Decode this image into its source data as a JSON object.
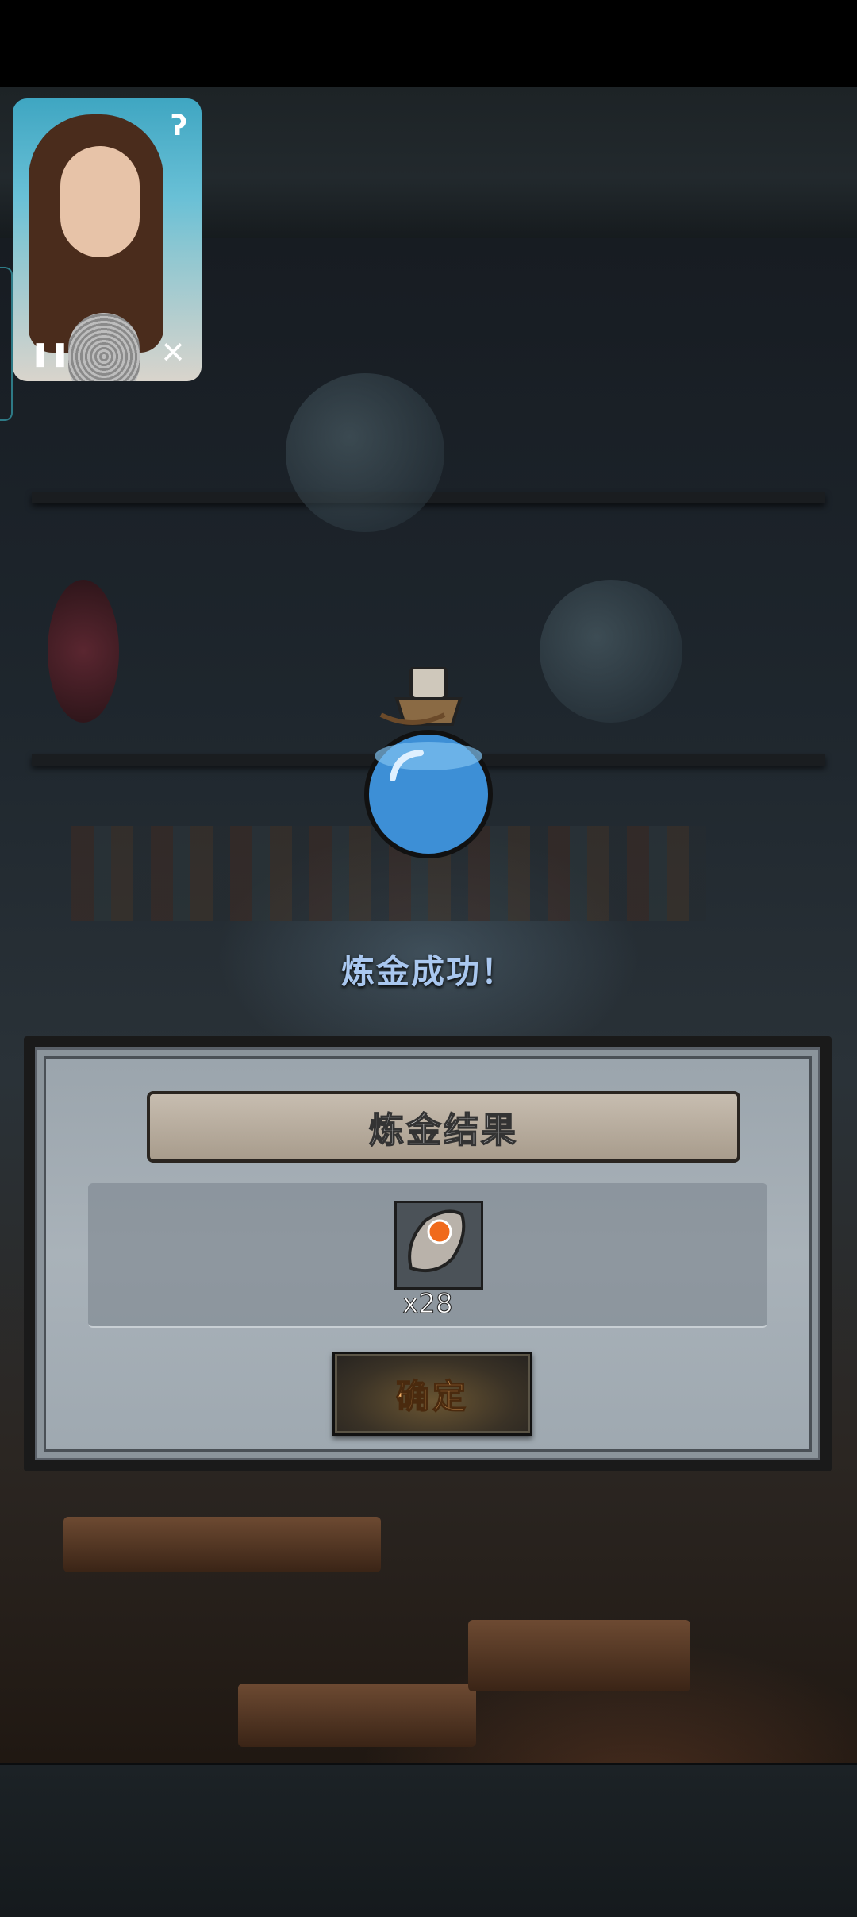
{
  "video_overlay": {
    "icons": {
      "listen": "ear-icon",
      "pause": "pause-icon",
      "close": "close-icon"
    },
    "pause_glyph": "❚❚",
    "close_glyph": "✕",
    "listen_glyph": "ʔ"
  },
  "alchemy": {
    "status_text": "炼金成功！",
    "potion_icon": "blue-potion-icon"
  },
  "result_dialog": {
    "title": "炼金结果",
    "items": [
      {
        "icon": "stone-ore-icon",
        "count_label": "x28"
      }
    ],
    "confirm_label": "确定"
  },
  "colors": {
    "status_text": "#a9c7ef",
    "confirm_text": "#f4b36a",
    "potion_blue": "#3d8fd6"
  }
}
